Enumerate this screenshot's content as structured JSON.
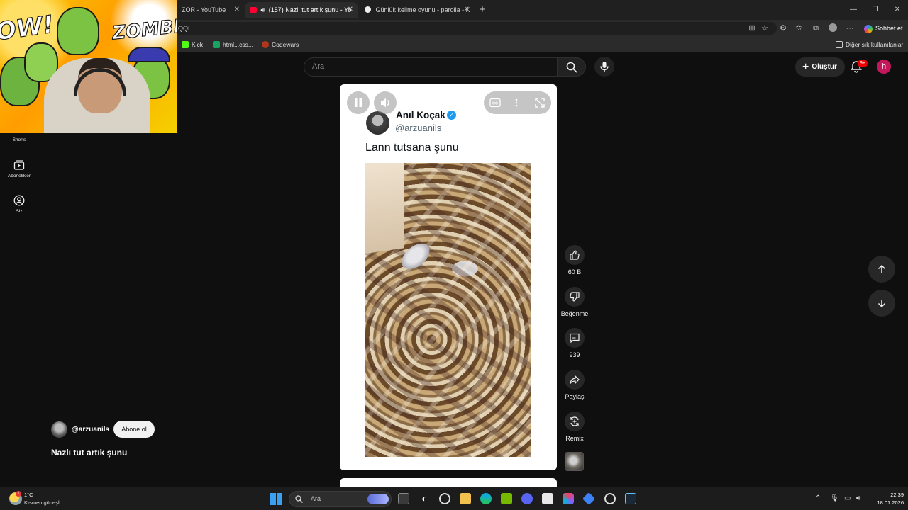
{
  "browser": {
    "tabs": [
      {
        "title": "ZOR - YouTube",
        "active": false
      },
      {
        "title": "(157) Nazlı tut artık şunu - Yo",
        "active": true
      },
      {
        "title": "Günlük kelime oyunu - parolla - K",
        "active": false
      }
    ],
    "url": "QQI",
    "chat_label": "Sohbet et",
    "bookmarks": [
      {
        "label": "Kick",
        "color": "#53fc18"
      },
      {
        "label": "html...css...",
        "color": "#1aa260"
      },
      {
        "label": "Codewars",
        "color": "#b1361e"
      }
    ],
    "other_bookmarks": "Diğer sık kullanılanlar"
  },
  "youtube": {
    "search_placeholder": "Ara",
    "create_label": "Oluştur",
    "notification_count": "9+",
    "avatar_letter": "h",
    "nav": [
      {
        "label": "Shorts",
        "icon": "shorts-icon"
      },
      {
        "label": "Abonelikler",
        "icon": "subscriptions-icon"
      },
      {
        "label": "Siz",
        "icon": "account-icon"
      }
    ]
  },
  "webcam": {
    "comic_words": [
      "OW!",
      "ZOMBIE!"
    ]
  },
  "short": {
    "tweet": {
      "author_name": "Anıl Koçak",
      "handle": "@arzuanils",
      "text": "Lann tutsana şunu"
    },
    "actions": {
      "like_count": "60 B",
      "dislike_label": "Beğenme",
      "comment_count": "939",
      "share_label": "Paylaş",
      "remix_label": "Remix"
    },
    "channel": {
      "handle": "@arzuanils",
      "subscribe_label": "Abone ol"
    },
    "title": "Nazlı tut artık şunu"
  },
  "taskbar": {
    "weather_temp": "1°C",
    "weather_desc": "Kısmen güneşli",
    "weather_badge": "1",
    "search_placeholder": "Ara",
    "time": "22:39",
    "date": "18.01.2026"
  },
  "colors": {
    "youtube_bg": "#0f0f0f",
    "verified_blue": "#1d9bf0",
    "avatar_pink": "#c2185b",
    "badge_red": "#e00000"
  }
}
